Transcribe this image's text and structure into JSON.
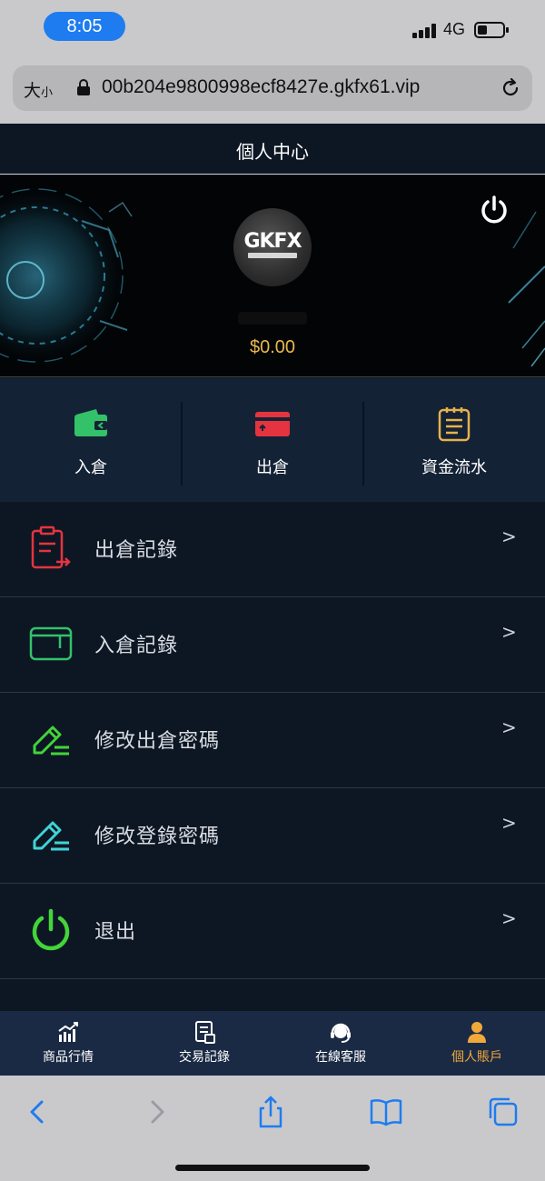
{
  "status_bar": {
    "time": "8:05",
    "network": "4G"
  },
  "browser": {
    "text_size_label": "大",
    "text_size_small": "小",
    "url": "00b204e9800998ecf8427e.gkfx61.vip"
  },
  "header": {
    "title": "個人中心"
  },
  "profile": {
    "logo_text": "GKFX",
    "balance": "$0.00"
  },
  "quick_actions": [
    {
      "label": "入倉",
      "icon": "wallet-icon",
      "color": "#33c26a"
    },
    {
      "label": "出倉",
      "icon": "card-icon",
      "color": "#e5343f"
    },
    {
      "label": "資金流水",
      "icon": "notepad-icon",
      "color": "#e6b34a"
    }
  ],
  "menu": [
    {
      "label": "出倉記錄",
      "icon": "withdraw-record-icon",
      "color": "#e5343f",
      "arrow": ">"
    },
    {
      "label": "入倉記錄",
      "icon": "deposit-record-icon",
      "color": "#33c26a",
      "arrow": ">"
    },
    {
      "label": "修改出倉密碼",
      "icon": "edit-pencil-icon",
      "color": "#43d43a",
      "arrow": ">"
    },
    {
      "label": "修改登錄密碼",
      "icon": "edit-pencil-icon",
      "color": "#3fd4d4",
      "arrow": ">"
    },
    {
      "label": "退出",
      "icon": "power-icon",
      "color": "#43d43a",
      "arrow": ">"
    }
  ],
  "bottom_nav": [
    {
      "label": "商品行情",
      "icon": "chart-icon",
      "active": false
    },
    {
      "label": "交易記錄",
      "icon": "receipt-icon",
      "active": false
    },
    {
      "label": "在線客服",
      "icon": "headset-icon",
      "active": false
    },
    {
      "label": "個人賬戶",
      "icon": "user-icon",
      "active": true
    }
  ],
  "colors": {
    "accent": "#f2a93b",
    "balance": "#e8b84c",
    "background": "#0d1724",
    "safari_blue": "#1e7cf0"
  }
}
